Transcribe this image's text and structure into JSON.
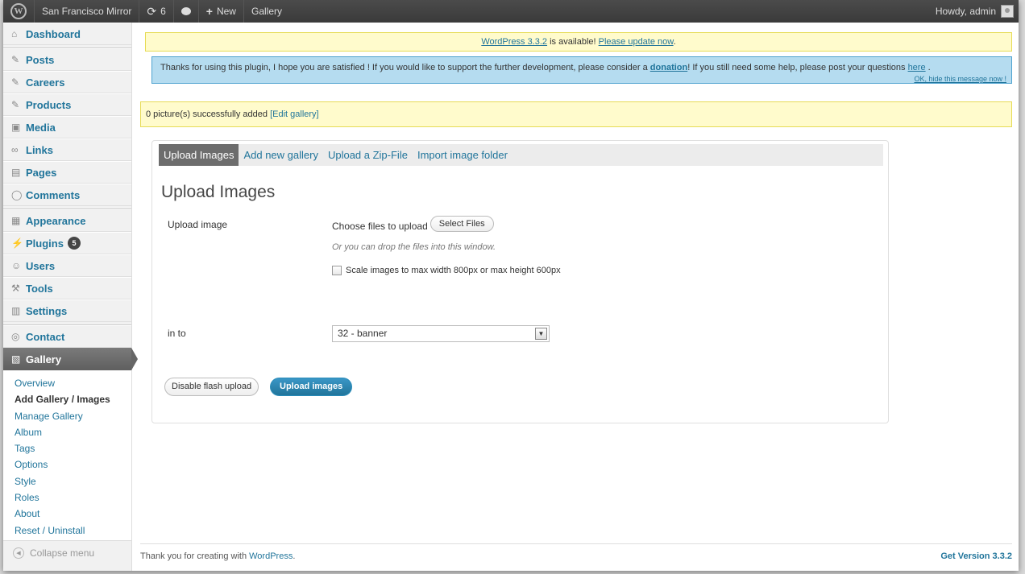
{
  "adminbar": {
    "logo": "W",
    "site_name": "San Francisco Mirror",
    "updates_count": "6",
    "new_label": "New",
    "gallery_label": "Gallery",
    "howdy": "Howdy, admin"
  },
  "sidebar": {
    "items": [
      {
        "label": "Dashboard",
        "icon": "home-icon",
        "glyph": "⌂"
      },
      {
        "label": "Posts",
        "icon": "pin-icon",
        "glyph": "✎"
      },
      {
        "label": "Careers",
        "icon": "pin-icon",
        "glyph": "✎"
      },
      {
        "label": "Products",
        "icon": "pin-icon",
        "glyph": "✎"
      },
      {
        "label": "Media",
        "icon": "media-icon",
        "glyph": "▣"
      },
      {
        "label": "Links",
        "icon": "link-icon",
        "glyph": "∞"
      },
      {
        "label": "Pages",
        "icon": "pages-icon",
        "glyph": "▤"
      },
      {
        "label": "Comments",
        "icon": "comment-icon",
        "glyph": "◯"
      },
      {
        "label": "Appearance",
        "icon": "appearance-icon",
        "glyph": "▦"
      },
      {
        "label": "Plugins",
        "icon": "plugin-icon",
        "glyph": "⚡",
        "badge": "5"
      },
      {
        "label": "Users",
        "icon": "users-icon",
        "glyph": "☺"
      },
      {
        "label": "Tools",
        "icon": "tools-icon",
        "glyph": "⚒"
      },
      {
        "label": "Settings",
        "icon": "settings-icon",
        "glyph": "▥"
      },
      {
        "label": "Contact",
        "icon": "contact-icon",
        "glyph": "◎"
      },
      {
        "label": "Gallery",
        "icon": "gallery-icon",
        "glyph": "▧"
      }
    ],
    "submenu": [
      "Overview",
      "Add Gallery / Images",
      "Manage Gallery",
      "Album",
      "Tags",
      "Options",
      "Style",
      "Roles",
      "About",
      "Reset / Uninstall"
    ],
    "collapse_label": "Collapse menu"
  },
  "notices": {
    "update_link": "WordPress 3.3.2",
    "update_text": " is available! ",
    "update_action": "Please update now",
    "update_end": ".",
    "plugin_text_1": "Thanks for using this plugin, I hope you are satisfied ! If you would like to support the further development, please consider a ",
    "plugin_donation": "donation",
    "plugin_text_2": "! If you still need some help, please post your questions ",
    "plugin_here": "here",
    "plugin_text_3": " .",
    "hide_message": "OK, hide this message now !",
    "added_text": "0 picture(s) successfully added ",
    "added_link": "[Edit gallery]"
  },
  "panel": {
    "tabs": [
      "Upload Images",
      "Add new gallery",
      "Upload a Zip-File",
      "Import image folder"
    ],
    "title": "Upload Images",
    "upload_label": "Upload image",
    "choose_files": "Choose files to upload",
    "select_files": "Select Files",
    "drop_hint": "Or you can drop the files into this window.",
    "scale_label": "Scale images to max width 800px or max height 600px",
    "into_label": "in to",
    "gallery_selected": "32 - banner",
    "disable_flash": "Disable flash upload",
    "upload_btn": "Upload images"
  },
  "footer": {
    "text": "Thank you for creating with ",
    "link": "WordPress",
    "end": ".",
    "version": "Get Version 3.3.2"
  }
}
